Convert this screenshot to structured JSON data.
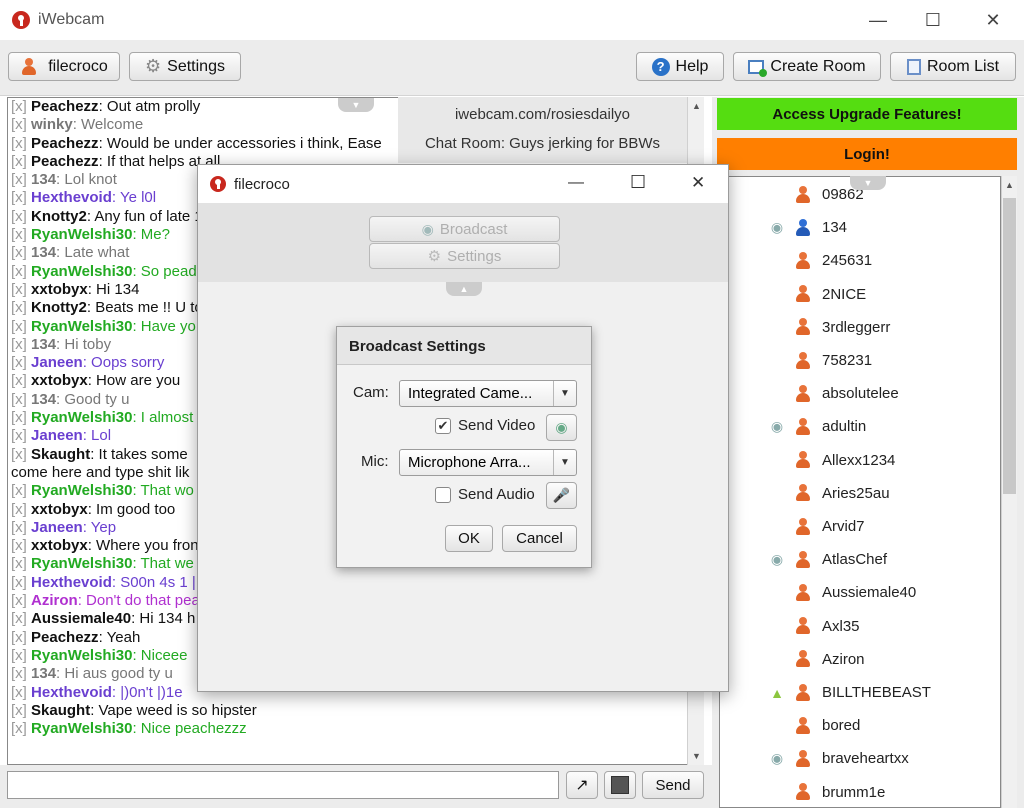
{
  "window": {
    "title": "iWebcam",
    "minimize": "—",
    "maximize": "☐",
    "close": "✕"
  },
  "toolbar": {
    "user_label": "filecroco",
    "settings_label": "Settings",
    "help_label": "Help",
    "create_room_label": "Create Room",
    "room_list_label": "Room List"
  },
  "room": {
    "url": "iwebcam.com/rosiesdailyo",
    "chat_room": "Chat Room: Guys jerking for BBWs"
  },
  "promo": {
    "upgrade_label": "Access Upgrade Features!",
    "login_label": "Login!",
    "upgrade_color": "#55dd11",
    "login_color": "#ff7f00"
  },
  "chat": {
    "lines": [
      {
        "user": "Peachezz",
        "msg": ": Out atm prolly",
        "c": "b"
      },
      {
        "user": "winky",
        "msg": ": Welcome",
        "c": "gr"
      },
      {
        "user": "Peachezz",
        "msg": ": Would be under accessories i think, Ease",
        "c": "b"
      },
      {
        "user": "Peachezz",
        "msg": ": If that helps at all",
        "c": "b"
      },
      {
        "user": "134",
        "msg": ": Lol knot",
        "c": "gr"
      },
      {
        "user": "Hexthevoid",
        "msg": ": Ye l0l",
        "c": "p"
      },
      {
        "user": "Knotty2",
        "msg": ": Any fun of late 1",
        "c": "b"
      },
      {
        "user": "RyanWelshi30",
        "msg": ": Me?",
        "c": "g"
      },
      {
        "user": "134",
        "msg": ": Late what",
        "c": "gr"
      },
      {
        "user": "RyanWelshi30",
        "msg": ": So pead",
        "c": "g"
      },
      {
        "user": "xxtobyx",
        "msg": ": Hi 134",
        "c": "b"
      },
      {
        "user": "Knotty2",
        "msg": ": Beats me !! U to",
        "c": "b"
      },
      {
        "user": "RyanWelshi30",
        "msg": ": Have yo",
        "c": "g"
      },
      {
        "user": "134",
        "msg": ": Hi toby",
        "c": "gr"
      },
      {
        "user": "Janeen",
        "msg": ": Oops sorry",
        "c": "p"
      },
      {
        "user": "xxtobyx",
        "msg": ": How are you",
        "c": "b"
      },
      {
        "user": "134",
        "msg": ": Good ty u",
        "c": "gr"
      },
      {
        "user": "RyanWelshi30",
        "msg": ": I almost",
        "c": "g"
      },
      {
        "user": "Janeen",
        "msg": ": Lol",
        "c": "p"
      },
      {
        "user": "Skaught",
        "msg": ": It takes some",
        "c": "b"
      },
      {
        "user": "",
        "msg": "come here and type shit lik",
        "c": "b",
        "cont": true
      },
      {
        "user": "RyanWelshi30",
        "msg": ": That wo",
        "c": "g"
      },
      {
        "user": "xxtobyx",
        "msg": ": Im good too",
        "c": "b"
      },
      {
        "user": "Janeen",
        "msg": ": Yep",
        "c": "p"
      },
      {
        "user": "xxtobyx",
        "msg": ": Where you fron",
        "c": "b"
      },
      {
        "user": "RyanWelshi30",
        "msg": ": That we",
        "c": "g"
      },
      {
        "user": "Hexthevoid",
        "msg": ": S00n 4s 1 |",
        "c": "p"
      },
      {
        "user": "Aziron",
        "msg": ": Don't do that pea",
        "c": "m"
      },
      {
        "user": "Aussiemale40",
        "msg": ": Hi 134 h",
        "c": "b"
      },
      {
        "user": "Peachezz",
        "msg": ": Yeah",
        "c": "b"
      },
      {
        "user": "RyanWelshi30",
        "msg": ": Niceee",
        "c": "g"
      },
      {
        "user": "134",
        "msg": ": Hi aus good ty u",
        "c": "gr"
      },
      {
        "user": "Hexthevoid",
        "msg": ": |)0n't |)1e",
        "c": "p"
      },
      {
        "user": "Skaught",
        "msg": ": Vape weed is so hipster",
        "c": "b"
      },
      {
        "user": "RyanWelshi30",
        "msg": ": Nice peachezzz",
        "c": "g"
      }
    ],
    "x_mark": "[x]",
    "send_label": "Send",
    "input_value": ""
  },
  "users": [
    {
      "name": "09862",
      "lead": "",
      "blue": false
    },
    {
      "name": "134",
      "lead": "cam",
      "blue": true
    },
    {
      "name": "245631",
      "lead": "",
      "blue": false
    },
    {
      "name": "2NICE",
      "lead": "",
      "blue": false
    },
    {
      "name": "3rdleggerr",
      "lead": "",
      "blue": false
    },
    {
      "name": "758231",
      "lead": "",
      "blue": false
    },
    {
      "name": "absolutelee",
      "lead": "",
      "blue": false
    },
    {
      "name": "adultin",
      "lead": "cam",
      "blue": false
    },
    {
      "name": "Allexx1234",
      "lead": "",
      "blue": false
    },
    {
      "name": "Aries25au",
      "lead": "",
      "blue": false
    },
    {
      "name": "Arvid7",
      "lead": "",
      "blue": false
    },
    {
      "name": "AtlasChef",
      "lead": "cam",
      "blue": false
    },
    {
      "name": "Aussiemale40",
      "lead": "",
      "blue": false
    },
    {
      "name": "Axl35",
      "lead": "",
      "blue": false
    },
    {
      "name": "Aziron",
      "lead": "",
      "blue": false
    },
    {
      "name": "BILLTHEBEAST",
      "lead": "android",
      "blue": false
    },
    {
      "name": "bored",
      "lead": "",
      "blue": false
    },
    {
      "name": "braveheartxx",
      "lead": "cam",
      "blue": false
    },
    {
      "name": "brumm1e",
      "lead": "",
      "blue": false
    }
  ],
  "dialog": {
    "title": "filecroco",
    "broadcast_label": "Broadcast",
    "settings_label": "Settings"
  },
  "broadcast_settings": {
    "title": "Broadcast Settings",
    "cam_label": "Cam:",
    "cam_value": "Integrated Came...",
    "send_video_label": "Send Video",
    "send_video_checked": true,
    "mic_label": "Mic:",
    "mic_value": "Microphone Arra...",
    "send_audio_label": "Send Audio",
    "send_audio_checked": false,
    "ok_label": "OK",
    "cancel_label": "Cancel"
  }
}
